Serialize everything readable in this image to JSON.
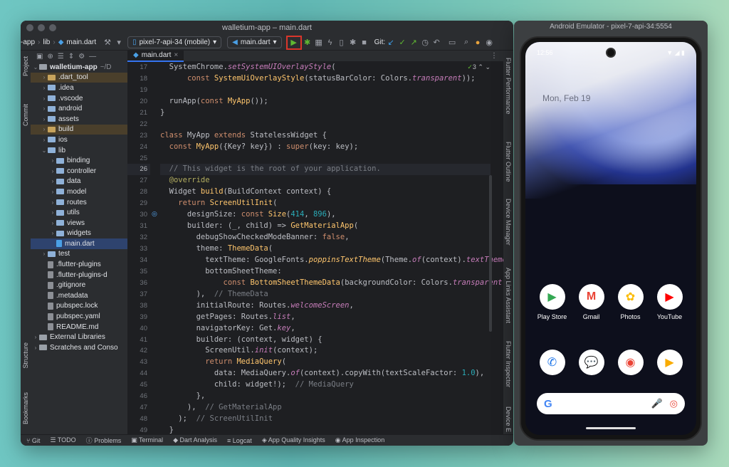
{
  "ide": {
    "window_title": "walletium-app – main.dart",
    "breadcrumb": [
      "-app",
      "lib",
      "main.dart"
    ],
    "device_selector": "pixel-7-api-34 (mobile)",
    "run_config": "main.dart",
    "git_label": "Git:",
    "tab_label": "main.dart",
    "inspection_count": "3",
    "left_strip": [
      "Project",
      "Commit",
      "Structure",
      "Bookmarks"
    ],
    "right_strip": [
      "Flutter Performance",
      "Flutter Outline",
      "Device Manager",
      "App Links Assistant",
      "Flutter Inspector",
      "Device E"
    ],
    "project_root": "walletium-app",
    "project_root_path": "~/D",
    "tree": [
      {
        "label": ".dart_tool",
        "level": 1,
        "kind": "folder-orange",
        "chev": "›",
        "hl": "orange"
      },
      {
        "label": ".idea",
        "level": 1,
        "kind": "folder",
        "chev": "›",
        "hl": ""
      },
      {
        "label": ".vscode",
        "level": 1,
        "kind": "folder",
        "chev": "›",
        "hl": ""
      },
      {
        "label": "android",
        "level": 1,
        "kind": "folder",
        "chev": "›",
        "hl": ""
      },
      {
        "label": "assets",
        "level": 1,
        "kind": "folder",
        "chev": "›",
        "hl": ""
      },
      {
        "label": "build",
        "level": 1,
        "kind": "folder-orange",
        "chev": "›",
        "hl": "orange"
      },
      {
        "label": "ios",
        "level": 1,
        "kind": "folder",
        "chev": "›",
        "hl": ""
      },
      {
        "label": "lib",
        "level": 1,
        "kind": "folder",
        "chev": "⌄",
        "hl": ""
      },
      {
        "label": "binding",
        "level": 2,
        "kind": "folder",
        "chev": "›",
        "hl": ""
      },
      {
        "label": "controller",
        "level": 2,
        "kind": "folder",
        "chev": "›",
        "hl": ""
      },
      {
        "label": "data",
        "level": 2,
        "kind": "folder",
        "chev": "›",
        "hl": ""
      },
      {
        "label": "model",
        "level": 2,
        "kind": "folder",
        "chev": "›",
        "hl": ""
      },
      {
        "label": "routes",
        "level": 2,
        "kind": "folder",
        "chev": "›",
        "hl": ""
      },
      {
        "label": "utils",
        "level": 2,
        "kind": "folder",
        "chev": "›",
        "hl": ""
      },
      {
        "label": "views",
        "level": 2,
        "kind": "folder",
        "chev": "›",
        "hl": ""
      },
      {
        "label": "widgets",
        "level": 2,
        "kind": "folder",
        "chev": "›",
        "hl": ""
      },
      {
        "label": "main.dart",
        "level": 2,
        "kind": "file-dart",
        "chev": "",
        "hl": "sel"
      },
      {
        "label": "test",
        "level": 1,
        "kind": "folder",
        "chev": "›",
        "hl": ""
      },
      {
        "label": ".flutter-plugins",
        "level": 1,
        "kind": "file",
        "chev": "",
        "hl": ""
      },
      {
        "label": ".flutter-plugins-d",
        "level": 1,
        "kind": "file",
        "chev": "",
        "hl": ""
      },
      {
        "label": ".gitignore",
        "level": 1,
        "kind": "file",
        "chev": "",
        "hl": ""
      },
      {
        "label": ".metadata",
        "level": 1,
        "kind": "file",
        "chev": "",
        "hl": ""
      },
      {
        "label": "pubspec.lock",
        "level": 1,
        "kind": "file",
        "chev": "",
        "hl": ""
      },
      {
        "label": "pubspec.yaml",
        "level": 1,
        "kind": "file",
        "chev": "",
        "hl": ""
      },
      {
        "label": "README.md",
        "level": 1,
        "kind": "file",
        "chev": "",
        "hl": ""
      },
      {
        "label": "External Libraries",
        "level": 0,
        "kind": "lib",
        "chev": "›",
        "hl": ""
      },
      {
        "label": "Scratches and Conso",
        "level": 0,
        "kind": "scratch",
        "chev": "›",
        "hl": ""
      }
    ],
    "code_lines": [
      {
        "n": "17",
        "html": "  <span class=\"cls\">SystemChrome</span>.<span class=\"it\">setSystemUIOverlayStyle</span>("
      },
      {
        "n": "18",
        "html": "      <span class=\"kw\">const</span> <span class=\"ys\">SystemUiOverlayStyle</span>(statusBarColor: Colors.<span class=\"it\">transparent</span>));"
      },
      {
        "n": "19",
        "html": ""
      },
      {
        "n": "20",
        "html": "  runApp(<span class=\"kw\">const</span> <span class=\"ys\">MyApp</span>());"
      },
      {
        "n": "21",
        "html": "}"
      },
      {
        "n": "22",
        "html": ""
      },
      {
        "n": "23",
        "html": "<span class=\"kw\">class</span> MyApp <span class=\"kw\">extends</span> StatelessWidget {"
      },
      {
        "n": "24",
        "html": "  <span class=\"kw\">const</span> <span class=\"ys\">MyApp</span>({Key? key}) : <span class=\"kw\">super</span>(key: key);"
      },
      {
        "n": "25",
        "html": ""
      },
      {
        "n": "26",
        "html": "  <span class=\"cm\">// This widget is the root of your application.</span>",
        "cur": true
      },
      {
        "n": "27",
        "html": "  <span class=\"ann\">@override</span>"
      },
      {
        "n": "28",
        "html": "  Widget <span class=\"ys\">build</span>(BuildContext context) {"
      },
      {
        "n": "29",
        "html": "    <span class=\"kw\">return</span> <span class=\"ys\">ScreenUtilInit</span>("
      },
      {
        "n": "30",
        "html": "      designSize: <span class=\"kw\">const</span> <span class=\"ys\">Size</span>(<span class=\"num\">414</span>, <span class=\"num\">896</span>),"
      },
      {
        "n": "31",
        "html": "      builder: (_, child) => <span class=\"ys\">GetMaterialApp</span>("
      },
      {
        "n": "32",
        "html": "        debugShowCheckedModeBanner: <span class=\"kw\">false</span>,"
      },
      {
        "n": "33",
        "html": "        theme: <span class=\"ys\">ThemeData</span>("
      },
      {
        "n": "34",
        "html": "          textTheme: GoogleFonts.<span class=\"it ys\">poppinsTextTheme</span>(Theme.<span class=\"it\">of</span>(context).<span class=\"it\">textTheme</span>),"
      },
      {
        "n": "35",
        "html": "          bottomSheetTheme:"
      },
      {
        "n": "36",
        "html": "              <span class=\"kw\">const</span> <span class=\"ys\">BottomSheetThemeData</span>(backgroundColor: Colors.<span class=\"it\">transparent</span>),"
      },
      {
        "n": "37",
        "html": "        ),  <span class=\"cm\">// ThemeData</span>"
      },
      {
        "n": "38",
        "html": "        initialRoute: Routes.<span class=\"it\">welcomeScreen</span>,"
      },
      {
        "n": "39",
        "html": "        getPages: Routes.<span class=\"it\">list</span>,"
      },
      {
        "n": "40",
        "html": "        navigatorKey: Get.<span class=\"it\">key</span>,"
      },
      {
        "n": "41",
        "html": "        builder: (context, widget) {"
      },
      {
        "n": "42",
        "html": "          ScreenUtil.<span class=\"it\">init</span>(context);"
      },
      {
        "n": "43",
        "html": "          <span class=\"kw\">return</span> <span class=\"ys\">MediaQuery</span>("
      },
      {
        "n": "44",
        "html": "            data: MediaQuery.<span class=\"it\">of</span>(context).copyWith(textScaleFactor: <span class=\"num\">1.0</span>),"
      },
      {
        "n": "45",
        "html": "            child: widget!);  <span class=\"cm\">// MediaQuery</span>"
      },
      {
        "n": "46",
        "html": "        },"
      },
      {
        "n": "47",
        "html": "      ),  <span class=\"cm\">// GetMaterialApp</span>"
      },
      {
        "n": "48",
        "html": "    );  <span class=\"cm\">// ScreenUtilInit</span>"
      },
      {
        "n": "49",
        "html": "  }"
      }
    ],
    "status_items": [
      "Git",
      "TODO",
      "Problems",
      "Terminal",
      "Dart Analysis",
      "Logcat",
      "App Quality Insights",
      "App Inspection"
    ]
  },
  "emulator": {
    "title": "Android Emulator - pixel-7-api-34:5554",
    "time": "12:56",
    "date": "Mon, Feb 19",
    "apps_row1": [
      {
        "label": "Play Store",
        "glyph": "▶",
        "color": "#34a853"
      },
      {
        "label": "Gmail",
        "glyph": "M",
        "color": "#ea4335"
      },
      {
        "label": "Photos",
        "glyph": "✿",
        "color": "#fbbc04"
      },
      {
        "label": "YouTube",
        "glyph": "▶",
        "color": "#ff0000"
      }
    ],
    "apps_row2": [
      {
        "glyph": "✆",
        "color": "#1a73e8"
      },
      {
        "glyph": "💬",
        "color": "#1a73e8"
      },
      {
        "glyph": "◉",
        "color": "#ea4335"
      },
      {
        "glyph": "▶",
        "color": "#f9ab00"
      }
    ],
    "search_g": "G"
  }
}
